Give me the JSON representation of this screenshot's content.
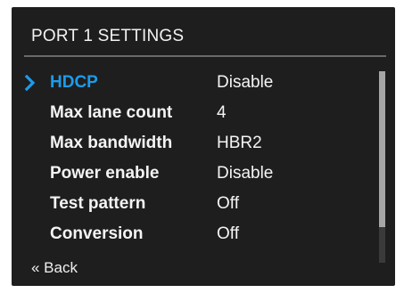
{
  "header": {
    "title": "PORT 1 SETTINGS"
  },
  "menu": {
    "items": [
      {
        "label": "HDCP",
        "value": "Disable",
        "selected": true
      },
      {
        "label": "Max lane count",
        "value": "4",
        "selected": false
      },
      {
        "label": "Max bandwidth",
        "value": "HBR2",
        "selected": false
      },
      {
        "label": "Power enable",
        "value": "Disable",
        "selected": false
      },
      {
        "label": "Test pattern",
        "value": "Off",
        "selected": false
      },
      {
        "label": "Conversion",
        "value": "Off",
        "selected": false
      }
    ],
    "pointer_icon": "chevron-right-icon"
  },
  "footer": {
    "back_label": "« Back"
  },
  "colors": {
    "background": "#1e1e1e",
    "accent": "#1e9be9",
    "text": "#f4f4f4"
  }
}
